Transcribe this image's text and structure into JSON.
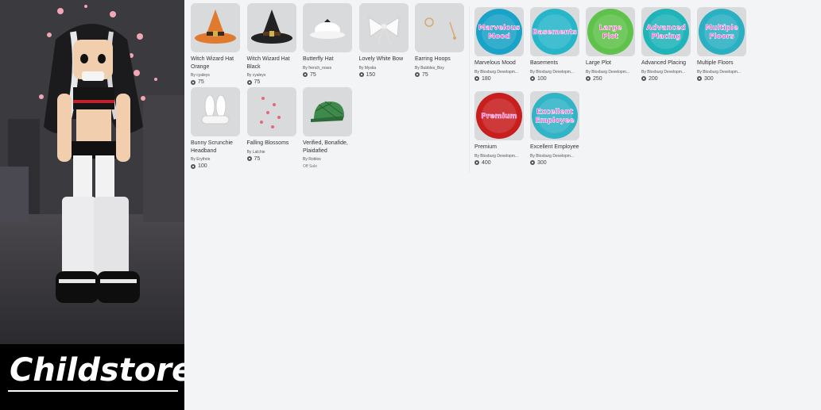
{
  "brand": {
    "title": "Childstore"
  },
  "accessories": [
    {
      "name": "Witch Wizard Hat Orange",
      "creator": "By cyaleys",
      "price": "75",
      "icon": "orange-witch-hat-icon",
      "color": "#e07a2e"
    },
    {
      "name": "Witch Wizard Hat Black",
      "creator": "By cyaleys",
      "price": "75",
      "icon": "black-witch-hat-icon",
      "color": "#222222"
    },
    {
      "name": "Butterfly Hat",
      "creator": "By french_roses",
      "price": "75",
      "icon": "butterfly-hat-icon",
      "color": "#ffffff"
    },
    {
      "name": "Lovely White Bow",
      "creator": "By Mystia",
      "price": "150",
      "icon": "white-bow-icon",
      "color": "#f4f4f4"
    },
    {
      "name": "Earring Hoops",
      "creator": "By Bubbles_Boy",
      "price": "75",
      "icon": "earring-hoops-icon",
      "color": "#d9a86b"
    },
    {
      "name": "Bunny Scrunchie Headband",
      "creator": "By Erythrie",
      "price": "100",
      "icon": "bunny-headband-icon",
      "color": "#ffffff"
    },
    {
      "name": "Falling Blossoms",
      "creator": "By Lalchie",
      "price": "75",
      "icon": "falling-blossoms-icon",
      "color": "#e06a7a"
    },
    {
      "name": "Verified, Bonafide, Plaidafied",
      "creator": "By Roblox",
      "offsale": "Off Sale",
      "icon": "green-plaid-cap-icon",
      "color": "#3e8a4a"
    }
  ],
  "gamepasses": [
    {
      "name": "Marvelous Mood",
      "creator": "By Bloxburg Developm...",
      "price": "180",
      "label": "Marvelous Mood",
      "bg": "#1aa3c8",
      "icon": "marvelous-mood-icon"
    },
    {
      "name": "Basements",
      "creator": "By Bloxburg Developm...",
      "price": "100",
      "label": "Basements",
      "bg": "#27b6c9",
      "icon": "basements-icon"
    },
    {
      "name": "Large Plot",
      "creator": "By Bloxburg Developm...",
      "price": "250",
      "label": "Large Plot",
      "bg": "#5fc24a",
      "icon": "large-plot-icon"
    },
    {
      "name": "Advanced Placing",
      "creator": "By Bloxburg Developm...",
      "price": "200",
      "label": "Advanced Placing",
      "bg": "#1fb4b8",
      "icon": "advanced-placing-icon"
    },
    {
      "name": "Multiple Floors",
      "creator": "By Bloxburg Developm...",
      "price": "300",
      "label": "Multiple Floors",
      "bg": "#2ab0c2",
      "icon": "multiple-floors-icon"
    },
    {
      "name": "Premium",
      "creator": "By Bloxburg Developm...",
      "price": "400",
      "label": "Premium",
      "bg": "#c81e1e",
      "icon": "premium-icon"
    },
    {
      "name": "Excellent Employee",
      "creator": "By Bloxburg Developm...",
      "price": "300",
      "label": "Excellent Employee",
      "bg": "#30b4c6",
      "icon": "excellent-employee-icon"
    }
  ]
}
